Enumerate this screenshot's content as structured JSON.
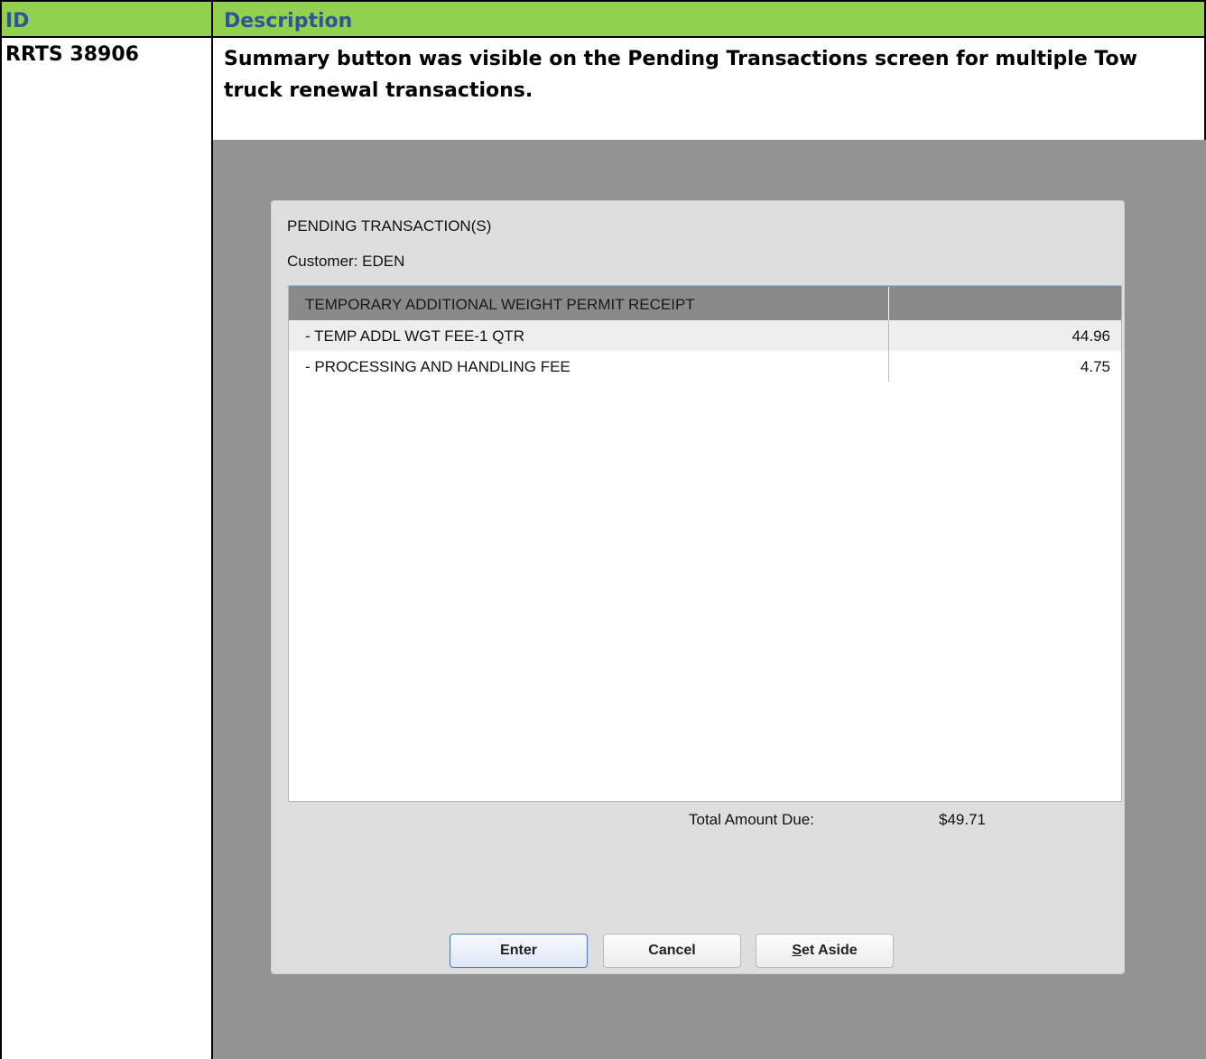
{
  "table": {
    "headers": {
      "id": "ID",
      "description": "Description"
    },
    "row": {
      "id": "RRTS 38906",
      "description": "Summary button was visible on the Pending Transactions screen for multiple Tow truck renewal transactions."
    }
  },
  "dialog": {
    "title": "PENDING TRANSACTION(S)",
    "customer": "Customer:  EDEN",
    "grid_header": "TEMPORARY ADDITIONAL WEIGHT PERMIT RECEIPT",
    "items": [
      {
        "label": "- TEMP ADDL WGT FEE-1 QTR",
        "amount": "44.96"
      },
      {
        "label": "- PROCESSING AND HANDLING FEE",
        "amount": "4.75"
      }
    ],
    "total_label": "Total Amount Due:",
    "total_value": "$49.71",
    "buttons": {
      "enter": "Enter",
      "cancel": "Cancel",
      "set_aside_first": "S",
      "set_aside_rest": "et Aside"
    }
  },
  "colors": {
    "header_bg": "#92d050",
    "header_text": "#2e5597",
    "screenshot_bg": "#939393"
  }
}
